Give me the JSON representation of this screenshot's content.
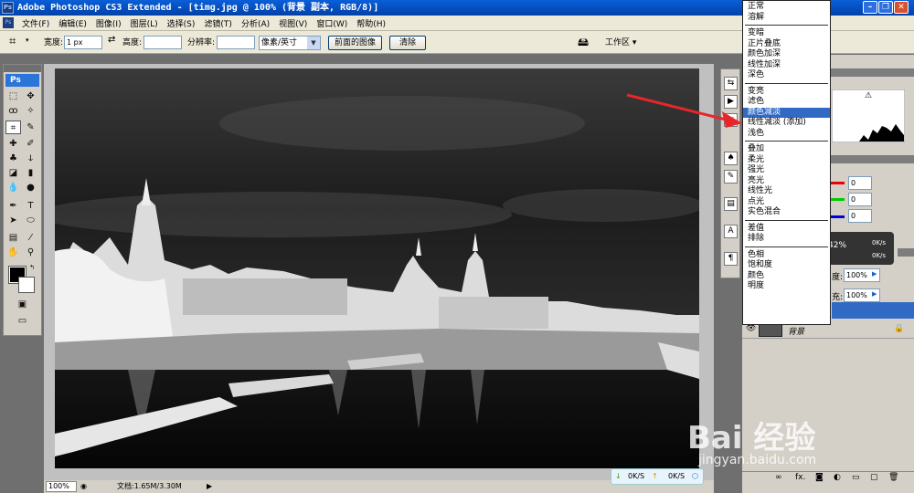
{
  "titlebar": {
    "title": "Adobe Photoshop CS3 Extended - [timg.jpg @ 100% (背景 副本, RGB/8)]",
    "ps_logo": "Ps"
  },
  "menubar": {
    "items": [
      "文件(F)",
      "编辑(E)",
      "图像(I)",
      "图层(L)",
      "选择(S)",
      "滤镜(T)",
      "分析(A)",
      "视图(V)",
      "窗口(W)",
      "帮助(H)"
    ]
  },
  "options": {
    "width_label": "宽度:",
    "width_value": "1 px",
    "height_label": "高度:",
    "height_value": "",
    "resolution_label": "分辨率:",
    "resolution_value": "",
    "units_value": "像素/英寸",
    "front_image_button": "前面的图像",
    "clear_button": "清除",
    "workspace_label": "工作区 ▾"
  },
  "toolbox": {
    "badge": "Ps"
  },
  "statusbar": {
    "zoom": "100%",
    "doc_info": "文档:1.65M/3.30M"
  },
  "blend_menu": {
    "groups": [
      [
        "正常",
        "溶解"
      ],
      [
        "变暗",
        "正片叠底",
        "颜色加深",
        "线性加深",
        "深色"
      ],
      [
        "变亮",
        "滤色",
        "颜色减淡",
        "线性减淡 (添加)",
        "浅色"
      ],
      [
        "叠加",
        "柔光",
        "强光",
        "亮光",
        "线性光",
        "点光",
        "实色混合"
      ],
      [
        "差值",
        "排除"
      ],
      [
        "色相",
        "饱和度",
        "颜色",
        "明度"
      ]
    ],
    "selected": "颜色减淡"
  },
  "color_panel": {
    "r_value": "0",
    "g_value": "0",
    "b_value": "0"
  },
  "layers_panel": {
    "opacity_label": "度:",
    "opacity_value": "100%",
    "fill_label": "充:",
    "fill_value": "100%",
    "layer_name": "背景",
    "footer_fx": "fx."
  },
  "netmon": {
    "down": "0K/S",
    "up": "0K/S",
    "badge_percent": "42%",
    "mini_down": "0K/s",
    "mini_up": "0K/s"
  },
  "watermark": {
    "brand": "Bai 经验",
    "url": "jingyan.baidu.com"
  },
  "colors": {
    "title_bar": "#0a5fd8",
    "menu_selected": "#316ac5",
    "arrow_red": "#e8262a"
  }
}
